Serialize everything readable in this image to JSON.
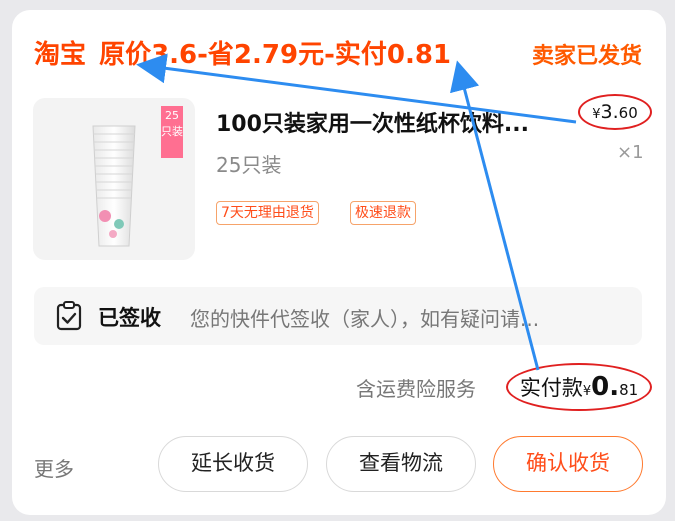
{
  "header": {
    "source": "淘宝",
    "summary": "原价3.6-省2.79元-实付0.81",
    "status": "卖家已发货"
  },
  "product": {
    "title": "100只装家用一次性纸杯饮料...",
    "spec": "25只装",
    "image_badge": "25只装",
    "price_symbol": "¥",
    "price_int": "3.",
    "price_dec": "60",
    "quantity": "×1",
    "tags": [
      "7天无理由退货",
      "极速退款"
    ]
  },
  "delivery": {
    "status_label": "已签收",
    "status_desc": "您的快件代签收（家人），如有疑问请..."
  },
  "payment": {
    "insurance": "含运费险服务",
    "label": "实付款",
    "symbol": "¥",
    "int": "0.",
    "dec": "81"
  },
  "actions": {
    "more": "更多",
    "extend": "延长收货",
    "logistics": "查看物流",
    "confirm": "确认收货"
  },
  "colors": {
    "accent": "#ff4400",
    "annotation": "#e02020",
    "arrow": "#2d8cf0"
  }
}
